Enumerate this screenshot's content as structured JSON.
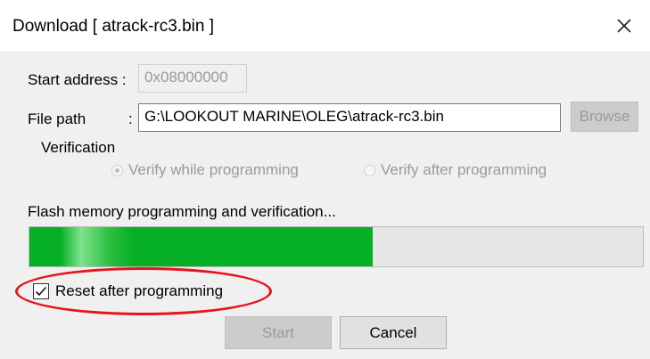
{
  "window": {
    "title": "Download [ atrack-rc3.bin ]"
  },
  "form": {
    "start_address_label": "Start address :",
    "start_address_value": "0x08000000",
    "file_path_label": "File path",
    "file_path_colon": ":",
    "file_path_value": "G:\\LOOKOUT MARINE\\OLEG\\atrack-rc3.bin",
    "browse_label": "Browse"
  },
  "verification": {
    "group_label": "Verification",
    "options": [
      {
        "label": "Verify while programming",
        "selected": true
      },
      {
        "label": "Verify after programming",
        "selected": false
      }
    ]
  },
  "progress": {
    "status_text": "Flash memory programming and verification...",
    "fraction": 0.56,
    "color": "#06b025"
  },
  "reset": {
    "label": "Reset after programming",
    "checked": true
  },
  "buttons": {
    "start_label": "Start",
    "cancel_label": "Cancel"
  },
  "icons": {
    "close": "close-icon"
  },
  "colors": {
    "highlight": "#e4161e"
  }
}
